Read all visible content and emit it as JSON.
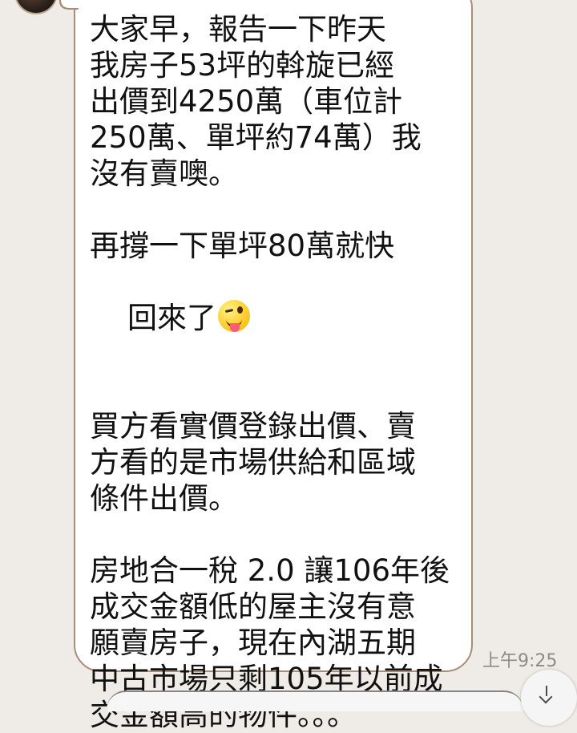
{
  "chat": {
    "message": {
      "lines": [
        "大家早，報告一下昨天",
        "我房子53坪的斡旋已經",
        "出價到4250萬（車位計",
        "250萬、單坪約74萬）我",
        "沒有賣噢。",
        "",
        "再撐一下單坪80萬就快",
        "回來了",
        "",
        "買方看實價登錄出價、賣",
        "方看的是市場供給和區域",
        "條件出價。",
        "",
        "房地合一稅 2.0 讓106年後",
        "成交金額低的屋主沒有意",
        "願賣房子，現在內湖五期",
        "中古市場只剩105年以前成",
        "交金額高的物件。。。"
      ],
      "emoji": "winking-face-with-tongue-emoji",
      "time": "上午9:25"
    },
    "controls": {
      "scroll_down_icon": "arrow-down-icon"
    }
  }
}
